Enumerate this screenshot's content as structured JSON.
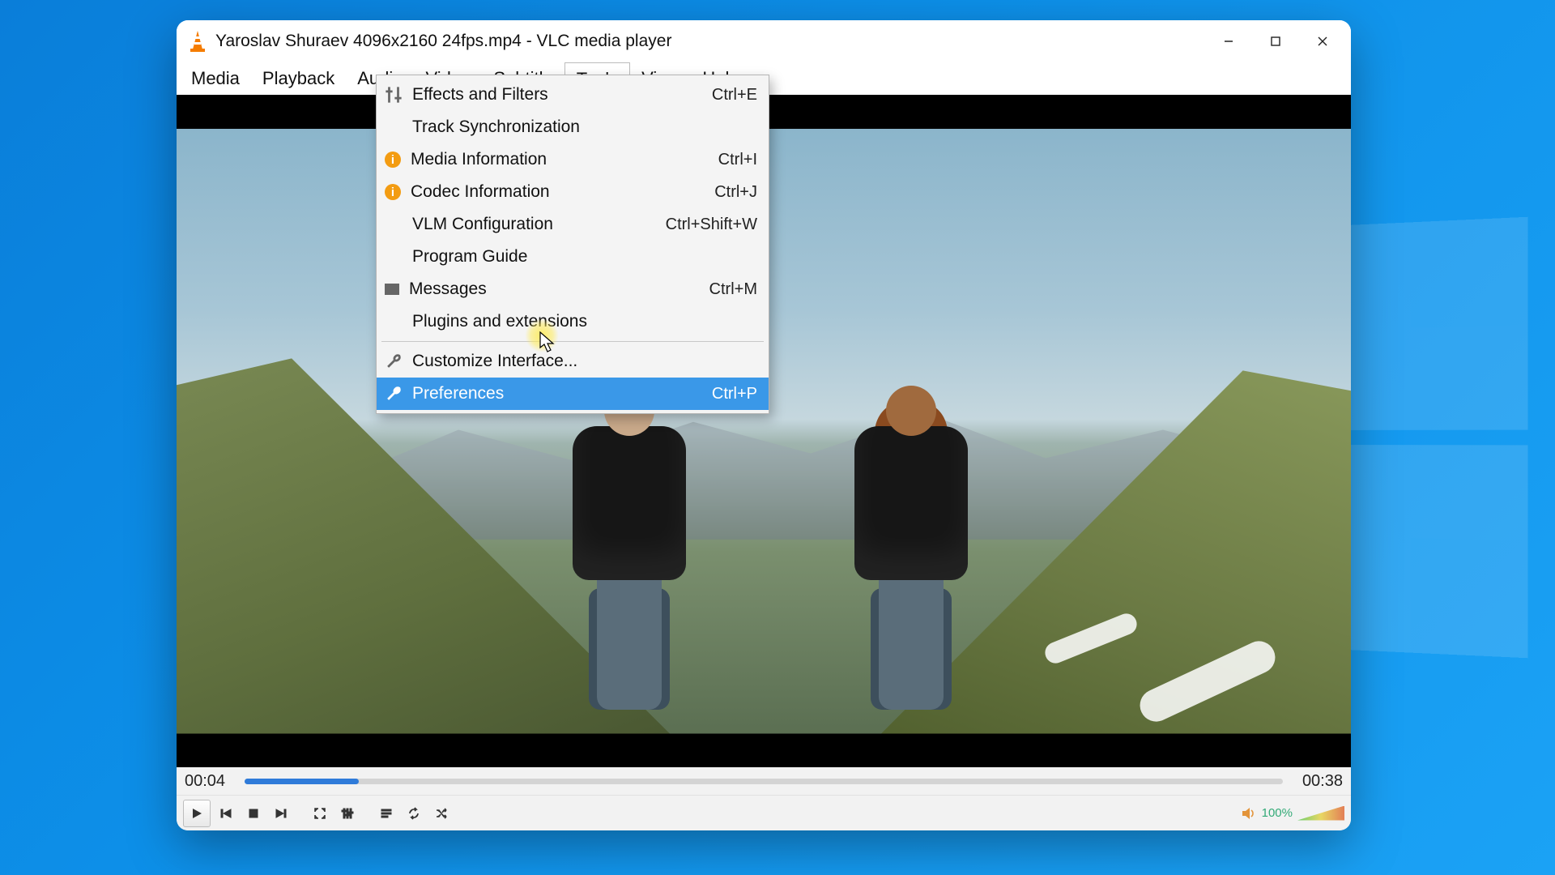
{
  "window": {
    "title": "Yaroslav Shuraev 4096x2160 24fps.mp4 - VLC media player"
  },
  "menubar": {
    "items": [
      "Media",
      "Playback",
      "Audio",
      "Video",
      "Subtitle",
      "Tools",
      "View",
      "Help"
    ],
    "open_index": 5
  },
  "tools_menu": {
    "groups": [
      [
        {
          "icon": "sliders",
          "label": "Effects and Filters",
          "shortcut": "Ctrl+E"
        },
        {
          "icon": "",
          "label": "Track Synchronization",
          "shortcut": ""
        },
        {
          "icon": "info",
          "label": "Media Information",
          "shortcut": "Ctrl+I"
        },
        {
          "icon": "info",
          "label": "Codec Information",
          "shortcut": "Ctrl+J"
        },
        {
          "icon": "",
          "label": "VLM Configuration",
          "shortcut": "Ctrl+Shift+W"
        },
        {
          "icon": "",
          "label": "Program Guide",
          "shortcut": ""
        },
        {
          "icon": "msg",
          "label": "Messages",
          "shortcut": "Ctrl+M"
        },
        {
          "icon": "",
          "label": "Plugins and extensions",
          "shortcut": ""
        }
      ],
      [
        {
          "icon": "wrench",
          "label": "Customize Interface...",
          "shortcut": ""
        },
        {
          "icon": "wrench",
          "label": "Preferences",
          "shortcut": "Ctrl+P",
          "highlight": true
        }
      ]
    ]
  },
  "playback": {
    "elapsed": "00:04",
    "total": "00:38",
    "progress_percent": 11
  },
  "volume": {
    "percent_label": "100%"
  }
}
